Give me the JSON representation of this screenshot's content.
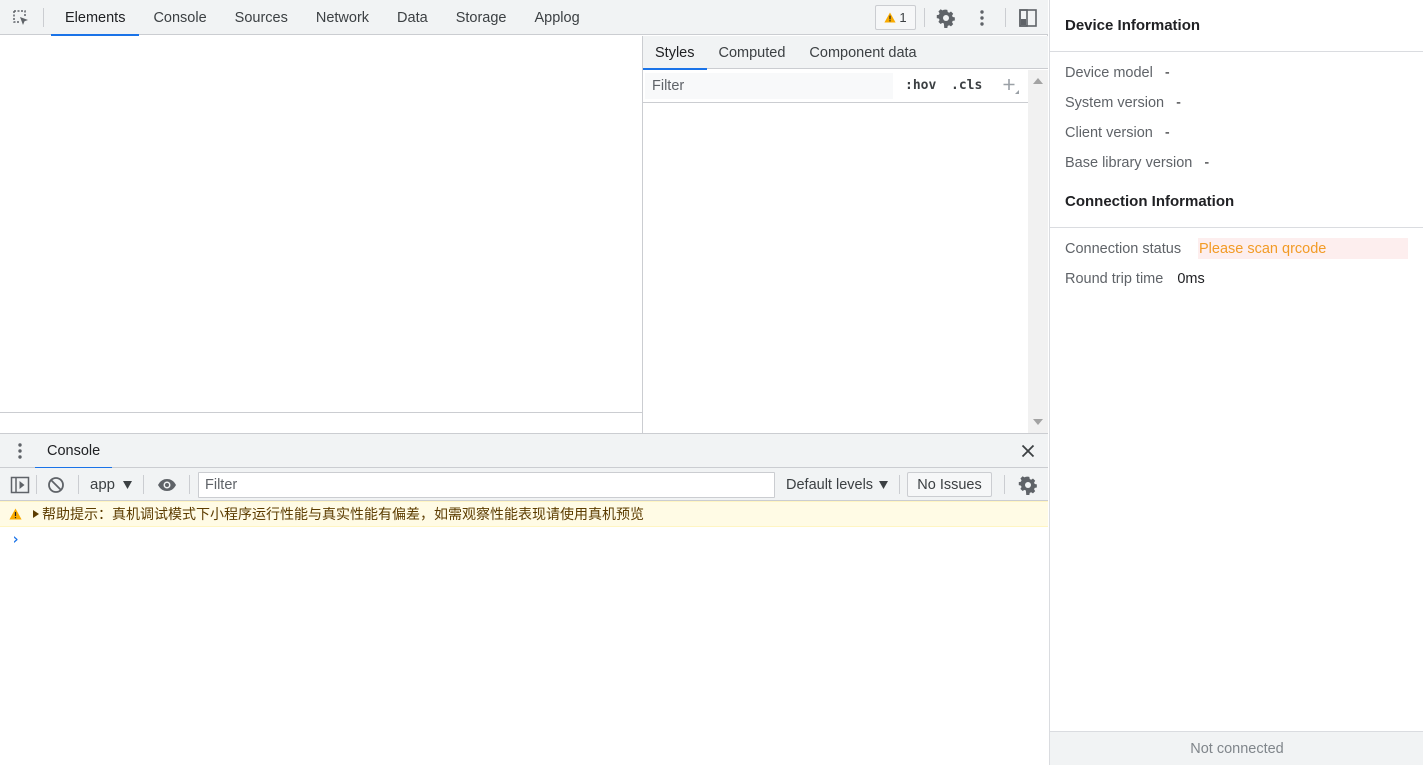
{
  "toolbar": {
    "inspect_icon": "inspect-element-icon",
    "tabs": [
      {
        "label": "Elements",
        "active": true
      },
      {
        "label": "Console",
        "active": false
      },
      {
        "label": "Sources",
        "active": false
      },
      {
        "label": "Network",
        "active": false
      },
      {
        "label": "Data",
        "active": false
      },
      {
        "label": "Storage",
        "active": false
      },
      {
        "label": "Applog",
        "active": false
      }
    ],
    "warning_count": "1",
    "settings_icon": "gear-icon",
    "more_icon": "kebab-menu-icon",
    "dock_icon": "dock-side-icon"
  },
  "styles_pane": {
    "tabs": [
      {
        "label": "Styles",
        "active": true
      },
      {
        "label": "Computed",
        "active": false
      },
      {
        "label": "Component data",
        "active": false
      }
    ],
    "filter_placeholder": "Filter",
    "hov_label": ":hov",
    "cls_label": ".cls"
  },
  "drawer": {
    "tab_label": "Console",
    "console_toolbar": {
      "context": "app",
      "filter_placeholder": "Filter",
      "levels": "Default levels",
      "issues": "No Issues"
    },
    "messages": [
      {
        "level": "warning",
        "text": "帮助提示：真机调试模式下小程序运行性能与真实性能有偏差，如需观察性能表现请使用真机预览"
      }
    ]
  },
  "info_panel": {
    "device_title": "Device Information",
    "device_rows": [
      {
        "label": "Device model",
        "value": "-"
      },
      {
        "label": "System version",
        "value": "-"
      },
      {
        "label": "Client version",
        "value": "-"
      },
      {
        "label": "Base library version",
        "value": "-"
      }
    ],
    "connection_title": "Connection Information",
    "connection_status_label": "Connection status",
    "connection_status_value": "Please scan qrcode",
    "round_trip_label": "Round trip time",
    "round_trip_value": "0ms",
    "status_bar": "Not connected"
  },
  "colors": {
    "accent": "#1a73e8",
    "warning_text": "#5c3c00",
    "warning_bg": "#fffbe5",
    "status_orange": "#f29b26"
  }
}
